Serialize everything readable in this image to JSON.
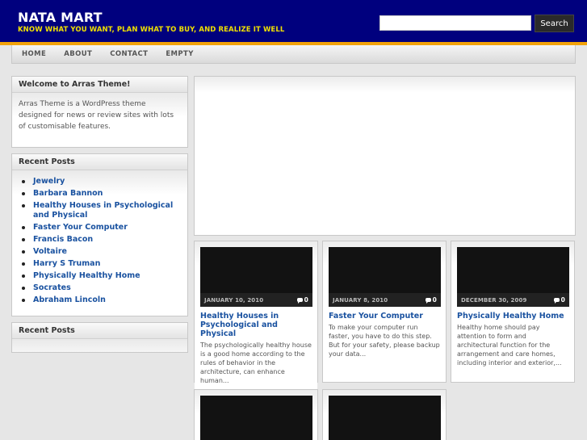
{
  "site": {
    "title": "NATA MART",
    "tagline": "KNOW WHAT YOU WANT, PLAN WHAT TO BUY, AND REALIZE IT WELL"
  },
  "search": {
    "placeholder": "",
    "button_label": "Search"
  },
  "nav": {
    "items": [
      "HOME",
      "ABOUT",
      "CONTACT",
      "EMPTY"
    ]
  },
  "sidebar": {
    "welcome": {
      "title": "Welcome to Arras Theme!",
      "body": "Arras Theme is a WordPress theme designed for news or review sites with lots of customisable features."
    },
    "recent_posts": {
      "title": "Recent Posts",
      "items": [
        "Jewelry",
        "Barbara Bannon",
        "Healthy Houses in Psychological and Physical",
        "Faster Your Computer",
        "Francis Bacon",
        "Voltaire",
        "Harry S Truman",
        "Physically Healthy Home",
        "Socrates",
        "Abraham Lincoln"
      ]
    },
    "recent_posts_2": {
      "title": "Recent Posts"
    }
  },
  "posts": [
    {
      "date": "JANUARY 10, 2010",
      "comments": "0",
      "title": "Healthy Houses in Psychological and Physical",
      "excerpt": "The psychologically healthy house is a good home according to the rules of behavior in the architecture, can enhance human..."
    },
    {
      "date": "JANUARY 8, 2010",
      "comments": "0",
      "title": "Faster Your Computer",
      "excerpt": "To make your computer run faster, you have to do this step. But for your safety, please backup your data..."
    },
    {
      "date": "DECEMBER 30, 2009",
      "comments": "0",
      "title": "Physically Healthy Home",
      "excerpt": "Healthy home should pay attention to form and architectural function for the arrangement and care homes, including interior and exterior,..."
    }
  ],
  "colors": {
    "header_bg": "#00007e",
    "tagline": "#f0e000",
    "accent_stripe": "#f2a20a",
    "link": "#1a52a0"
  }
}
